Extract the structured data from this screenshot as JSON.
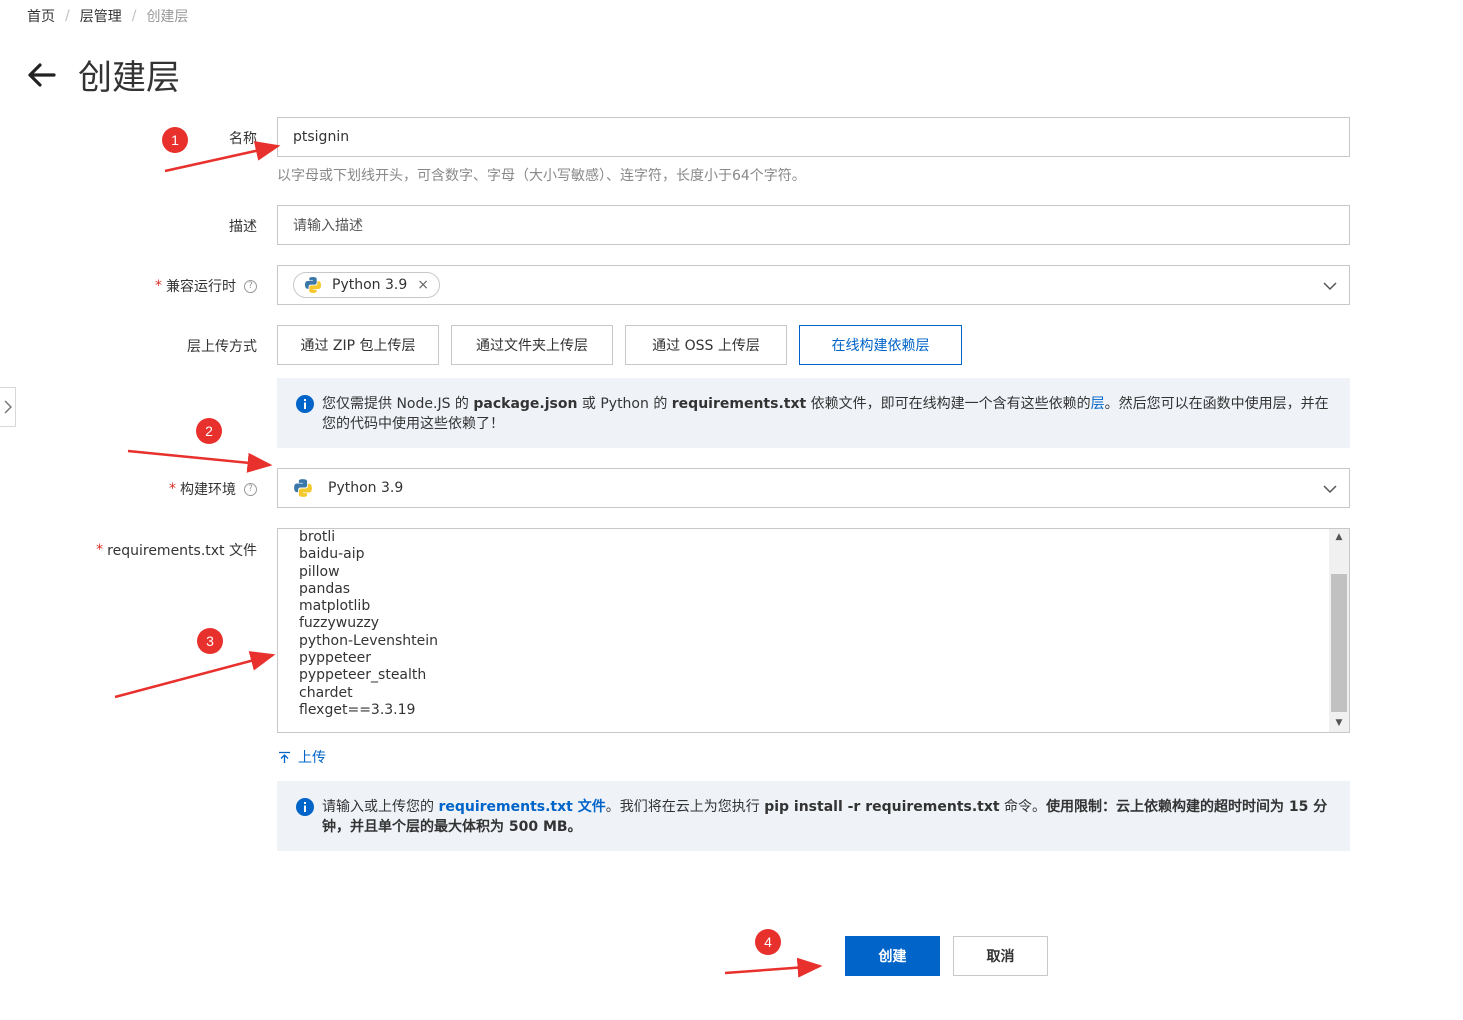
{
  "breadcrumb": {
    "home": "首页",
    "sep": "/",
    "parent": "层管理",
    "current": "创建层"
  },
  "page": {
    "title": "创建层"
  },
  "form": {
    "name_label": "名称",
    "name_value": "ptsignin",
    "name_hint": "以字母或下划线开头，可含数字、字母（大小写敏感）、连字符，长度小于64个字符。",
    "desc_label": "描述",
    "desc_placeholder": "请输入描述",
    "required_mark": "*",
    "help_mark": "?",
    "runtime_label": "兼容运行时",
    "runtime_tag": "Python 3.9",
    "tag_close": "×",
    "upload_method_label": "层上传方式",
    "upload_tabs": [
      "通过 ZIP 包上传层",
      "通过文件夹上传层",
      "通过 OSS 上传层",
      "在线构建依赖层"
    ],
    "info1": {
      "t1": "您仅需提供 Node.JS 的 ",
      "b1": "package.json",
      "t2": " 或 Python 的 ",
      "b2": "requirements.txt",
      "t3": " 依赖文件，即可在线构建一个含有这些依赖的",
      "link": "层",
      "t4": "。然后您可以在函数中使用层，并在您的代码中使用这些依赖了！"
    },
    "build_env_label": "构建环境",
    "build_env_value": "Python 3.9",
    "requirements_label": "requirements.txt 文件",
    "requirements_lines": [
      "brotli",
      "baidu-aip",
      "pillow",
      "pandas",
      "matplotlib",
      "fuzzywuzzy",
      "python-Levenshtein",
      "pyppeteer",
      "pyppeteer_stealth",
      "chardet",
      "flexget==3.3.19"
    ],
    "upload_link": "上传",
    "info2": {
      "t1": "请输入或上传您的 ",
      "link": "requirements.txt 文件",
      "t2": "。我们将在云上为您执行 ",
      "b1": "pip install -r requirements.txt",
      "t3": " 命令。",
      "b2": "使用限制：云上依赖构建的超时时间为 15 分钟，并且单个层的最大体积为 500 MB。"
    }
  },
  "actions": {
    "create": "创建",
    "cancel": "取消"
  },
  "annotations": {
    "n1": "1",
    "n2": "2",
    "n3": "3",
    "n4": "4"
  },
  "colors": {
    "accent": "#0064c8",
    "annotation": "#e8302c",
    "info_bg": "#eff3f8"
  }
}
